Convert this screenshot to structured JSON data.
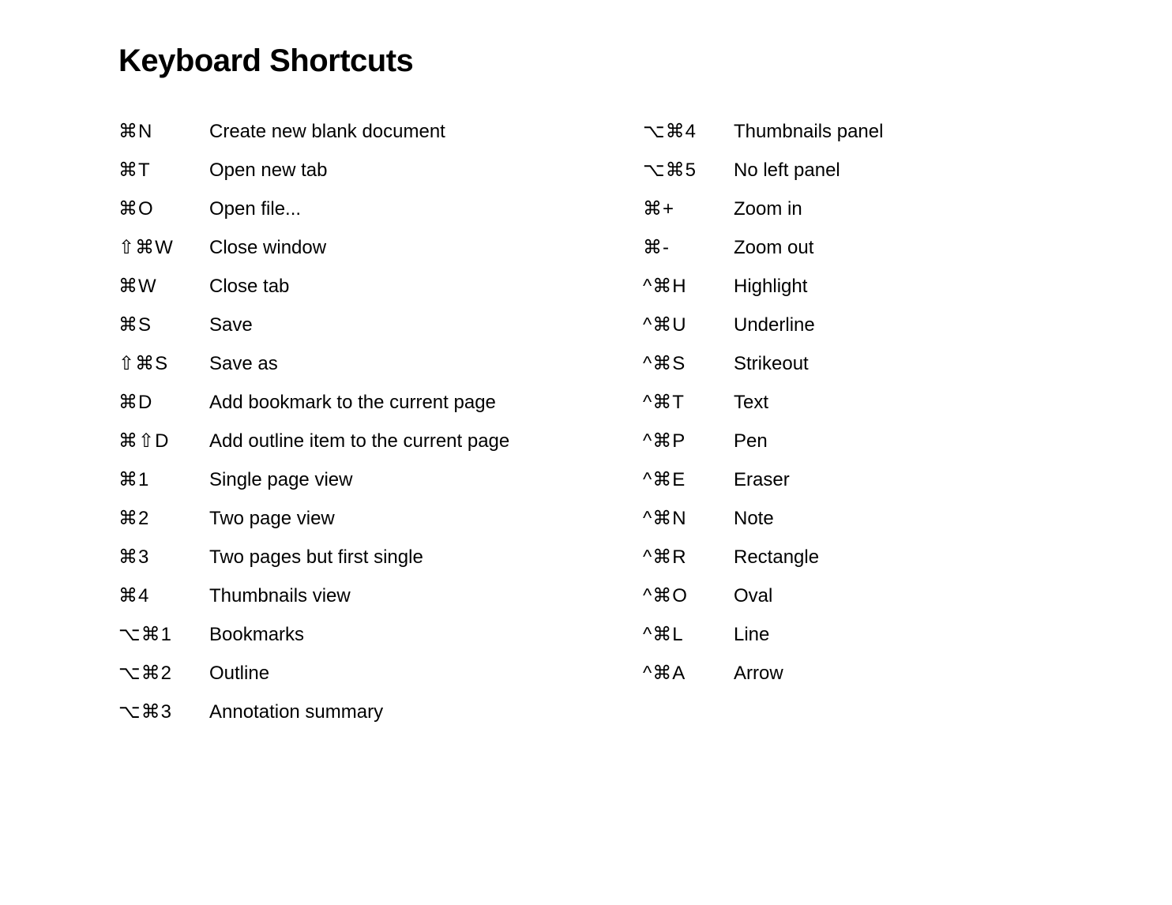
{
  "title": "Keyboard Shortcuts",
  "left": [
    {
      "keys": "⌘N",
      "desc": "Create new blank document"
    },
    {
      "keys": "⌘T",
      "desc": "Open new tab"
    },
    {
      "keys": "⌘O",
      "desc": "Open file..."
    },
    {
      "keys": "⇧⌘W",
      "desc": "Close window"
    },
    {
      "keys": "⌘W",
      "desc": "Close tab"
    },
    {
      "keys": "⌘S",
      "desc": "Save"
    },
    {
      "keys": "⇧⌘S",
      "desc": "Save as"
    },
    {
      "keys": "⌘D",
      "desc": "Add bookmark to the current page"
    },
    {
      "keys": "⌘⇧D",
      "desc": "Add outline item to the current page"
    },
    {
      "keys": "⌘1",
      "desc": "Single page view"
    },
    {
      "keys": "⌘2",
      "desc": "Two page view"
    },
    {
      "keys": "⌘3",
      "desc": "Two pages but first single"
    },
    {
      "keys": "⌘4",
      "desc": "Thumbnails view"
    },
    {
      "keys": "⌥⌘1",
      "desc": "Bookmarks"
    },
    {
      "keys": "⌥⌘2",
      "desc": "Outline"
    },
    {
      "keys": "⌥⌘3",
      "desc": "Annotation summary"
    }
  ],
  "right": [
    {
      "keys": "⌥⌘4",
      "desc": "Thumbnails panel"
    },
    {
      "keys": "⌥⌘5",
      "desc": "No left panel"
    },
    {
      "keys": "⌘+",
      "desc": "Zoom in"
    },
    {
      "keys": "⌘-",
      "desc": "Zoom out"
    },
    {
      "keys": "^⌘H",
      "desc": "Highlight"
    },
    {
      "keys": "^⌘U",
      "desc": "Underline"
    },
    {
      "keys": "^⌘S",
      "desc": "Strikeout"
    },
    {
      "keys": "^⌘T",
      "desc": "Text"
    },
    {
      "keys": "^⌘P",
      "desc": "Pen"
    },
    {
      "keys": "^⌘E",
      "desc": "Eraser"
    },
    {
      "keys": "^⌘N",
      "desc": "Note"
    },
    {
      "keys": "^⌘R",
      "desc": "Rectangle"
    },
    {
      "keys": "^⌘O",
      "desc": "Oval"
    },
    {
      "keys": "^⌘L",
      "desc": "Line"
    },
    {
      "keys": "^⌘A",
      "desc": "Arrow"
    }
  ]
}
